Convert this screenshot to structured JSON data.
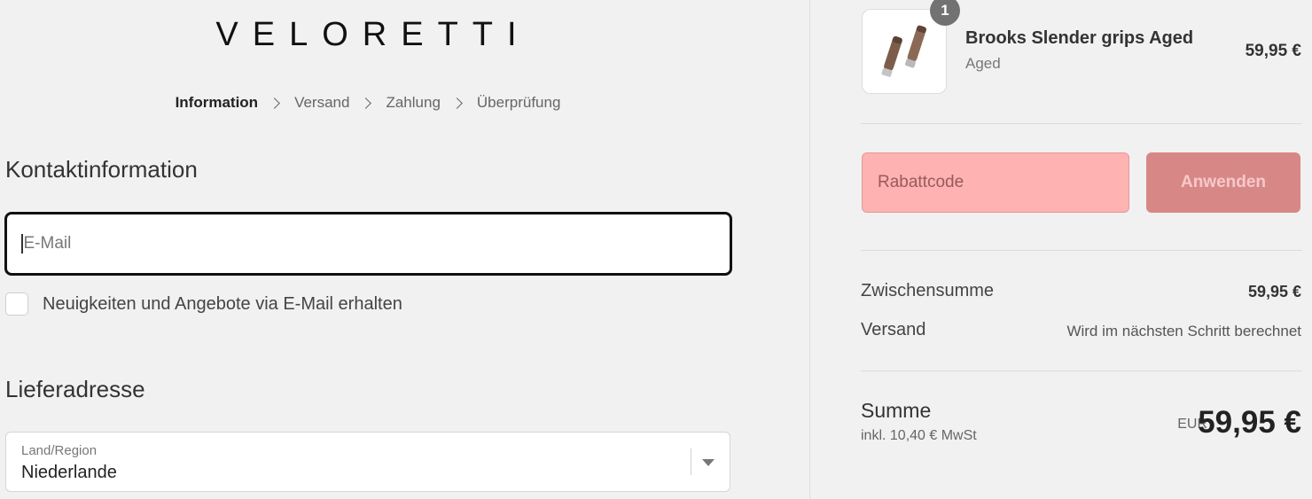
{
  "brand": {
    "logo_text": "VELORETTI"
  },
  "breadcrumb": {
    "steps": [
      "Information",
      "Versand",
      "Zahlung",
      "Überprüfung"
    ]
  },
  "contact": {
    "heading": "Kontaktinformation",
    "email_placeholder": "E-Mail",
    "newsletter_label": "Neuigkeiten und Angebote via E-Mail erhalten"
  },
  "shipping_address": {
    "heading": "Lieferadresse",
    "country_label": "Land/Region",
    "country_value": "Niederlande"
  },
  "order_summary": {
    "product": {
      "quantity_badge": "1",
      "name": "Brooks Slender grips Aged",
      "variant": "Aged",
      "price": "59,95 €"
    },
    "discount": {
      "placeholder": "Rabattcode",
      "apply_label": "Anwenden"
    },
    "subtotal_label": "Zwischensumme",
    "subtotal_value": "59,95 €",
    "shipping_label": "Versand",
    "shipping_value": "Wird im nächsten Schritt berechnet",
    "total_label": "Summe",
    "tax_note": "inkl. 10,40 € MwSt",
    "currency": "EUR",
    "total_value": "59,95 €"
  },
  "colors": {
    "discount_bg": "#ffb2b2",
    "apply_button_bg": "#d88787"
  }
}
